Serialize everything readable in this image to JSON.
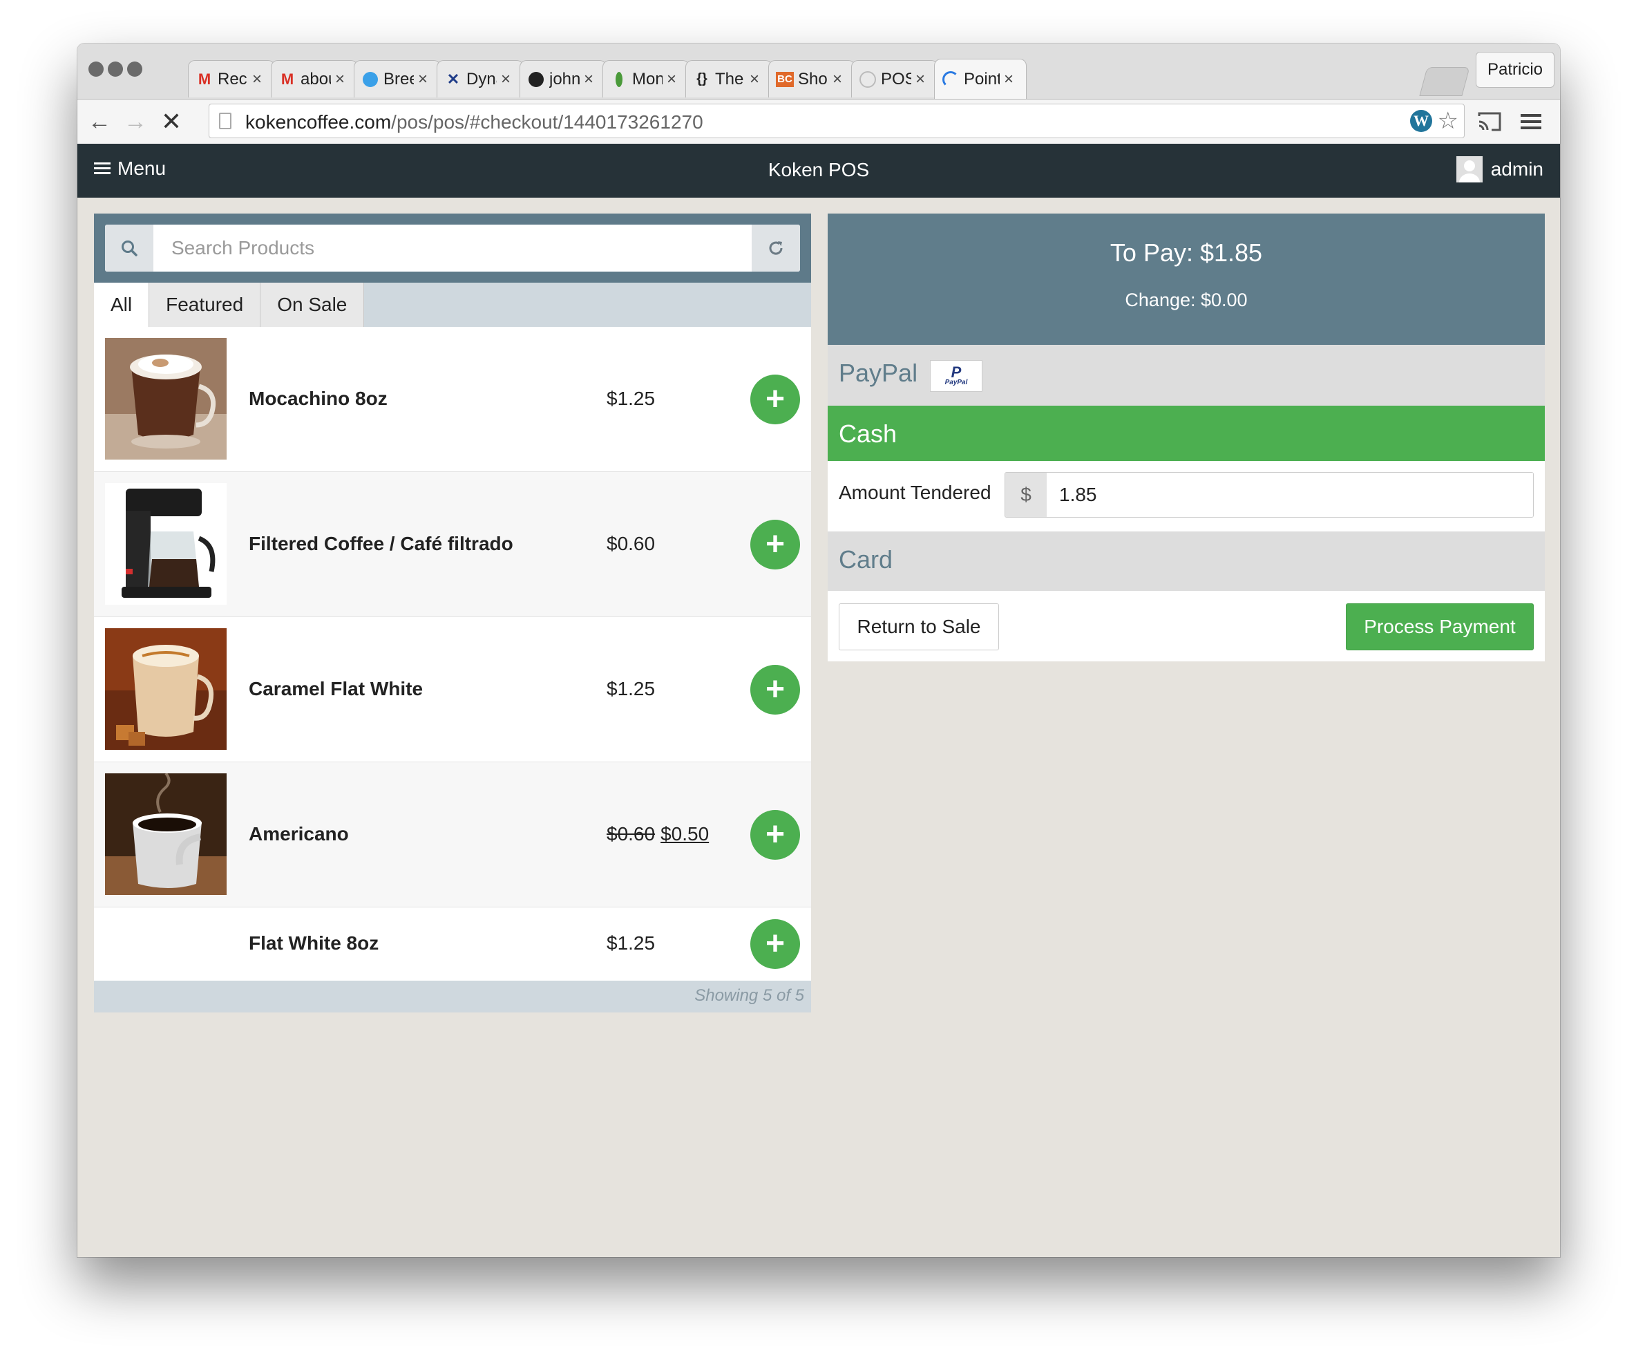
{
  "browser": {
    "profile": "Patricio",
    "tabs": [
      {
        "title": "Recibid",
        "icon": "gmail-icon"
      },
      {
        "title": "about g",
        "icon": "gmail-icon"
      },
      {
        "title": "Breezy",
        "icon": "breezy-icon"
      },
      {
        "title": "Dynami",
        "icon": "dynamics-icon"
      },
      {
        "title": "johnpap",
        "icon": "github-icon"
      },
      {
        "title": "Mongol",
        "icon": "mongodb-icon"
      },
      {
        "title": "The Birt",
        "icon": "braces-icon"
      },
      {
        "title": "Shoppi",
        "icon": "bigcommerce-icon"
      },
      {
        "title": "POS ‹ K",
        "icon": "wordpress-icon"
      },
      {
        "title": "Point of",
        "icon": "loading-spinner-icon"
      }
    ],
    "url_host": "kokencoffee.com",
    "url_path": "/pos/pos/#checkout/1440173261270"
  },
  "app": {
    "menu_label": "Menu",
    "title": "Koken POS",
    "user": "admin"
  },
  "products": {
    "search_placeholder": "Search Products",
    "tabs": [
      "All",
      "Featured",
      "On Sale"
    ],
    "active_tab": "All",
    "items": [
      {
        "name": "Mocachino 8oz",
        "price": "$1.25",
        "has_image": true
      },
      {
        "name": "Filtered Coffee / Café filtrado",
        "price": "$0.60",
        "has_image": true
      },
      {
        "name": "Caramel Flat White",
        "price": "$1.25",
        "has_image": true
      },
      {
        "name": "Americano",
        "old_price": "$0.60",
        "price": "$0.50",
        "has_image": true
      },
      {
        "name": "Flat White 8oz",
        "price": "$1.25",
        "has_image": false
      }
    ],
    "footer": "Showing 5 of 5"
  },
  "checkout": {
    "to_pay": "To Pay: $1.85",
    "change": "Change: $0.00",
    "gateways": {
      "paypal": "PayPal",
      "paypal_logo_text": "PayPal",
      "cash": "Cash",
      "card": "Card"
    },
    "amount_tendered_label": "Amount Tendered",
    "currency_symbol": "$",
    "amount_tendered_value": "1.85",
    "return_button": "Return to Sale",
    "process_button": "Process Payment"
  },
  "colors": {
    "header": "#263238",
    "summary": "#607d8b",
    "accent_green": "#4caf50",
    "background": "#e6e3dd"
  }
}
